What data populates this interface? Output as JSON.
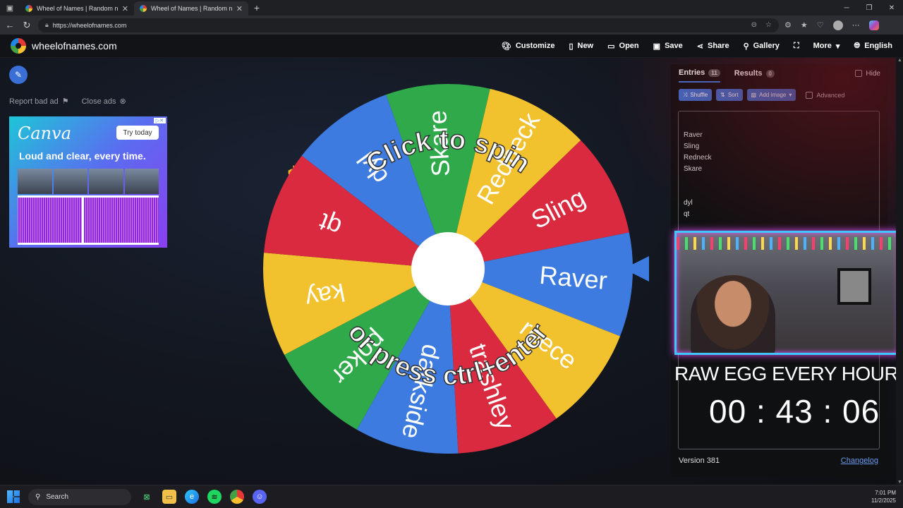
{
  "browser": {
    "tabs": [
      {
        "title": "Wheel of Names | Random name"
      },
      {
        "title": "Wheel of Names | Random name"
      }
    ],
    "url": "https://wheelofnames.com"
  },
  "site": {
    "name": "wheelofnames.com",
    "menu": [
      "Customize",
      "New",
      "Open",
      "Save",
      "Share",
      "Gallery",
      "More",
      "English"
    ]
  },
  "ads": {
    "report_label": "Report bad ad",
    "close_label": "Close ads",
    "brand": "Canva",
    "cta": "Try today",
    "slogan": "Loud and clear, every time."
  },
  "wheel": {
    "center_text_top": "Click to spin",
    "center_text_bottom": "or press ctrl+enter",
    "slices": [
      {
        "label": "Raver",
        "color": "#3d7be0"
      },
      {
        "label": "reece",
        "color": "#f2c12e"
      },
      {
        "label": "trashley",
        "color": "#d92a3f"
      },
      {
        "label": "darkside",
        "color": "#3d7be0"
      },
      {
        "label": "poker",
        "color": "#2fa94a"
      },
      {
        "label": "kay",
        "color": "#f2c12e"
      },
      {
        "label": "qt",
        "color": "#d92a3f"
      },
      {
        "label": "dyl",
        "color": "#3d7be0"
      },
      {
        "label": "Skare",
        "color": "#2fa94a"
      },
      {
        "label": "Redneck",
        "color": "#f2c12e"
      },
      {
        "label": "Sling",
        "color": "#d92a3f"
      }
    ]
  },
  "panel": {
    "entries_tab": "Entries",
    "entries_count": "11",
    "results_tab": "Results",
    "results_count": "0",
    "hide_label": "Hide",
    "shuffle_label": "Shuffle",
    "sort_label": "Sort",
    "add_image_label": "Add image",
    "advanced_label": "Advanced",
    "entries_text": [
      "Raver",
      "Sling",
      "Redneck",
      "Skare",
      "",
      "",
      "dyl",
      "qt"
    ],
    "version": "Version 381",
    "changelog": "Changelog"
  },
  "stream": {
    "title": "RAW EGG EVERY HOUR",
    "timer": "00 : 43 : 06"
  },
  "taskbar": {
    "search_placeholder": "Search",
    "time": "7:01 PM",
    "date": "11/2/2025"
  }
}
